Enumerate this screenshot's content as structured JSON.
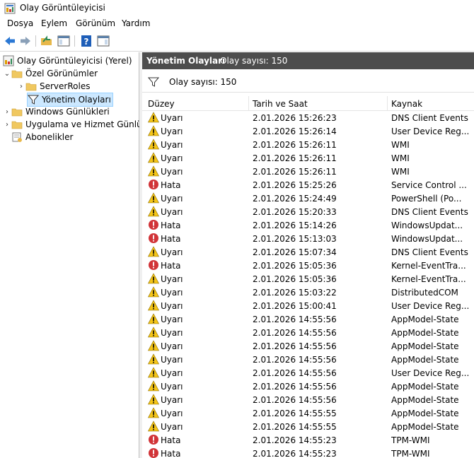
{
  "window": {
    "title": "Olay Görüntüleyicisi"
  },
  "menu": [
    "Dosya",
    "Eylem",
    "Görünüm",
    "Yardım"
  ],
  "toolbar": [
    "back-arrow-icon",
    "forward-arrow-icon",
    "open-folder-icon",
    "console-tree-icon",
    "help-icon",
    "action-pane-icon"
  ],
  "tree": {
    "root": "Olay Görüntüleyicisi (Yerel)",
    "custom_views": "Özel Görünümler",
    "server_roles": "ServerRoles",
    "admin_events": "Yönetim Olayları",
    "windows_logs": "Windows Günlükleri",
    "app_service_logs": "Uygulama ve Hizmet Günlük",
    "subscriptions": "Abonelikler"
  },
  "panel": {
    "title": "Yönetim Olayları",
    "count": "Olay sayısı: 150",
    "filter_text": "Olay sayısı: 150"
  },
  "columns": {
    "level": "Düzey",
    "datetime": "Tarih ve Saat",
    "source": "Kaynak"
  },
  "events": [
    {
      "level": "Uyarı",
      "type": "warning",
      "datetime": "2.01.2026 15:26:23",
      "source": "DNS Client Events"
    },
    {
      "level": "Uyarı",
      "type": "warning",
      "datetime": "2.01.2026 15:26:14",
      "source": "User Device Reg..."
    },
    {
      "level": "Uyarı",
      "type": "warning",
      "datetime": "2.01.2026 15:26:11",
      "source": "WMI"
    },
    {
      "level": "Uyarı",
      "type": "warning",
      "datetime": "2.01.2026 15:26:11",
      "source": "WMI"
    },
    {
      "level": "Uyarı",
      "type": "warning",
      "datetime": "2.01.2026 15:26:11",
      "source": "WMI"
    },
    {
      "level": "Hata",
      "type": "error",
      "datetime": "2.01.2026 15:25:26",
      "source": "Service Control ..."
    },
    {
      "level": "Uyarı",
      "type": "warning",
      "datetime": "2.01.2026 15:24:49",
      "source": "PowerShell (Po..."
    },
    {
      "level": "Uyarı",
      "type": "warning",
      "datetime": "2.01.2026 15:20:33",
      "source": "DNS Client Events"
    },
    {
      "level": "Hata",
      "type": "error",
      "datetime": "2.01.2026 15:14:26",
      "source": "WindowsUpdat..."
    },
    {
      "level": "Hata",
      "type": "error",
      "datetime": "2.01.2026 15:13:03",
      "source": "WindowsUpdat..."
    },
    {
      "level": "Uyarı",
      "type": "warning",
      "datetime": "2.01.2026 15:07:34",
      "source": "DNS Client Events"
    },
    {
      "level": "Hata",
      "type": "error",
      "datetime": "2.01.2026 15:05:36",
      "source": "Kernel-EventTra..."
    },
    {
      "level": "Uyarı",
      "type": "warning",
      "datetime": "2.01.2026 15:05:36",
      "source": "Kernel-EventTra..."
    },
    {
      "level": "Uyarı",
      "type": "warning",
      "datetime": "2.01.2026 15:03:22",
      "source": "DistributedCOM"
    },
    {
      "level": "Uyarı",
      "type": "warning",
      "datetime": "2.01.2026 15:00:41",
      "source": "User Device Reg..."
    },
    {
      "level": "Uyarı",
      "type": "warning",
      "datetime": "2.01.2026 14:55:56",
      "source": "AppModel-State"
    },
    {
      "level": "Uyarı",
      "type": "warning",
      "datetime": "2.01.2026 14:55:56",
      "source": "AppModel-State"
    },
    {
      "level": "Uyarı",
      "type": "warning",
      "datetime": "2.01.2026 14:55:56",
      "source": "AppModel-State"
    },
    {
      "level": "Uyarı",
      "type": "warning",
      "datetime": "2.01.2026 14:55:56",
      "source": "AppModel-State"
    },
    {
      "level": "Uyarı",
      "type": "warning",
      "datetime": "2.01.2026 14:55:56",
      "source": "User Device Reg..."
    },
    {
      "level": "Uyarı",
      "type": "warning",
      "datetime": "2.01.2026 14:55:56",
      "source": "AppModel-State"
    },
    {
      "level": "Uyarı",
      "type": "warning",
      "datetime": "2.01.2026 14:55:56",
      "source": "AppModel-State"
    },
    {
      "level": "Uyarı",
      "type": "warning",
      "datetime": "2.01.2026 14:55:55",
      "source": "AppModel-State"
    },
    {
      "level": "Uyarı",
      "type": "warning",
      "datetime": "2.01.2026 14:55:55",
      "source": "AppModel-State"
    },
    {
      "level": "Hata",
      "type": "error",
      "datetime": "2.01.2026 14:55:23",
      "source": "TPM-WMI"
    },
    {
      "level": "Hata",
      "type": "error",
      "datetime": "2.01.2026 14:55:23",
      "source": "TPM-WMI"
    }
  ],
  "colors": {
    "header_band": "#4d4d4d",
    "selection": "#cce8ff",
    "warning": "#f5c518",
    "error": "#d13438"
  }
}
